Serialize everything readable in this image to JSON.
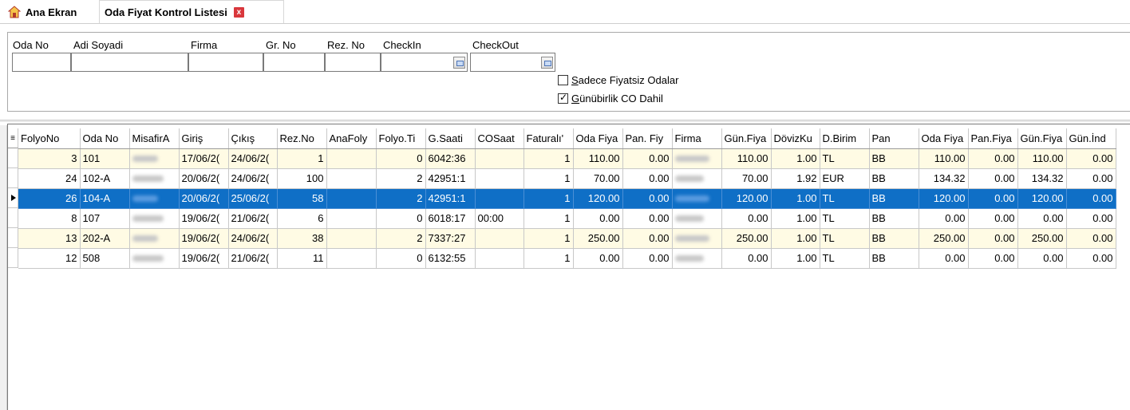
{
  "tabs": {
    "home_label": "Ana Ekran",
    "active_label": "Oda Fiyat Kontrol Listesi",
    "close_glyph": "x"
  },
  "filters": {
    "labels": [
      "Oda No",
      "Adi Soyadi",
      "Firma",
      "Gr. No",
      "Rez. No",
      "CheckIn",
      "CheckOut"
    ],
    "checkbox_sadece": {
      "label_first": "S",
      "label_rest": "adece Fiyatsiz Odalar",
      "checked": false
    },
    "checkbox_gunubirlik": {
      "label_first": "G",
      "label_rest": "ünübirlik CO Dahil",
      "checked": true
    }
  },
  "grid": {
    "header_icon": "column-chooser-icon",
    "columns": [
      "FolyoNo",
      "Oda No",
      "MisafirA",
      "Giriş",
      "Çıkış",
      "Rez.No",
      "AnaFoly",
      "Folyo.Ti",
      "G.Saati",
      "COSaat",
      "Faturalı'",
      "Oda Fiya",
      "Pan. Fiy",
      "Firma",
      "Gün.Fiya",
      "DövizKu",
      "D.Birim",
      "Pan",
      "Oda Fiya",
      "Pan.Fiya",
      "Gün.Fiya",
      "Gün.İnd"
    ],
    "rows": [
      {
        "style": "yel",
        "cells": [
          "3",
          "101",
          "",
          "17/06/2(",
          "24/06/2(",
          "1",
          "",
          "0",
          "6042:36",
          "",
          "1",
          "110.00",
          "0.00",
          "",
          "110.00",
          "1.00",
          "TL",
          "BB",
          "110.00",
          "0.00",
          "110.00",
          "0.00"
        ]
      },
      {
        "style": "",
        "cells": [
          "24",
          "102-A",
          "",
          "20/06/2(",
          "24/06/2(",
          "100",
          "",
          "2",
          "42951:1",
          "",
          "1",
          "70.00",
          "0.00",
          "",
          "70.00",
          "1.92",
          "EUR",
          "BB",
          "134.32",
          "0.00",
          "134.32",
          "0.00"
        ]
      },
      {
        "style": "sel",
        "cells": [
          "26",
          "104-A",
          "",
          "20/06/2(",
          "25/06/2(",
          "58",
          "",
          "2",
          "42951:1",
          "",
          "1",
          "120.00",
          "0.00",
          "",
          "120.00",
          "1.00",
          "TL",
          "BB",
          "120.00",
          "0.00",
          "120.00",
          "0.00"
        ]
      },
      {
        "style": "",
        "cells": [
          "8",
          "107",
          "",
          "19/06/2(",
          "21/06/2(",
          "6",
          "",
          "0",
          "6018:17",
          "00:00",
          "1",
          "0.00",
          "0.00",
          "",
          "0.00",
          "1.00",
          "TL",
          "BB",
          "0.00",
          "0.00",
          "0.00",
          "0.00"
        ]
      },
      {
        "style": "yel",
        "cells": [
          "13",
          "202-A",
          "",
          "19/06/2(",
          "24/06/2(",
          "38",
          "",
          "2",
          "7337:27",
          "",
          "1",
          "250.00",
          "0.00",
          "",
          "250.00",
          "1.00",
          "TL",
          "BB",
          "250.00",
          "0.00",
          "250.00",
          "0.00"
        ]
      },
      {
        "style": "",
        "cells": [
          "12",
          "508",
          "",
          "19/06/2(",
          "21/06/2(",
          "11",
          "",
          "0",
          "6132:55",
          "",
          "1",
          "0.00",
          "0.00",
          "",
          "0.00",
          "1.00",
          "TL",
          "BB",
          "0.00",
          "0.00",
          "0.00",
          "0.00"
        ]
      }
    ]
  }
}
